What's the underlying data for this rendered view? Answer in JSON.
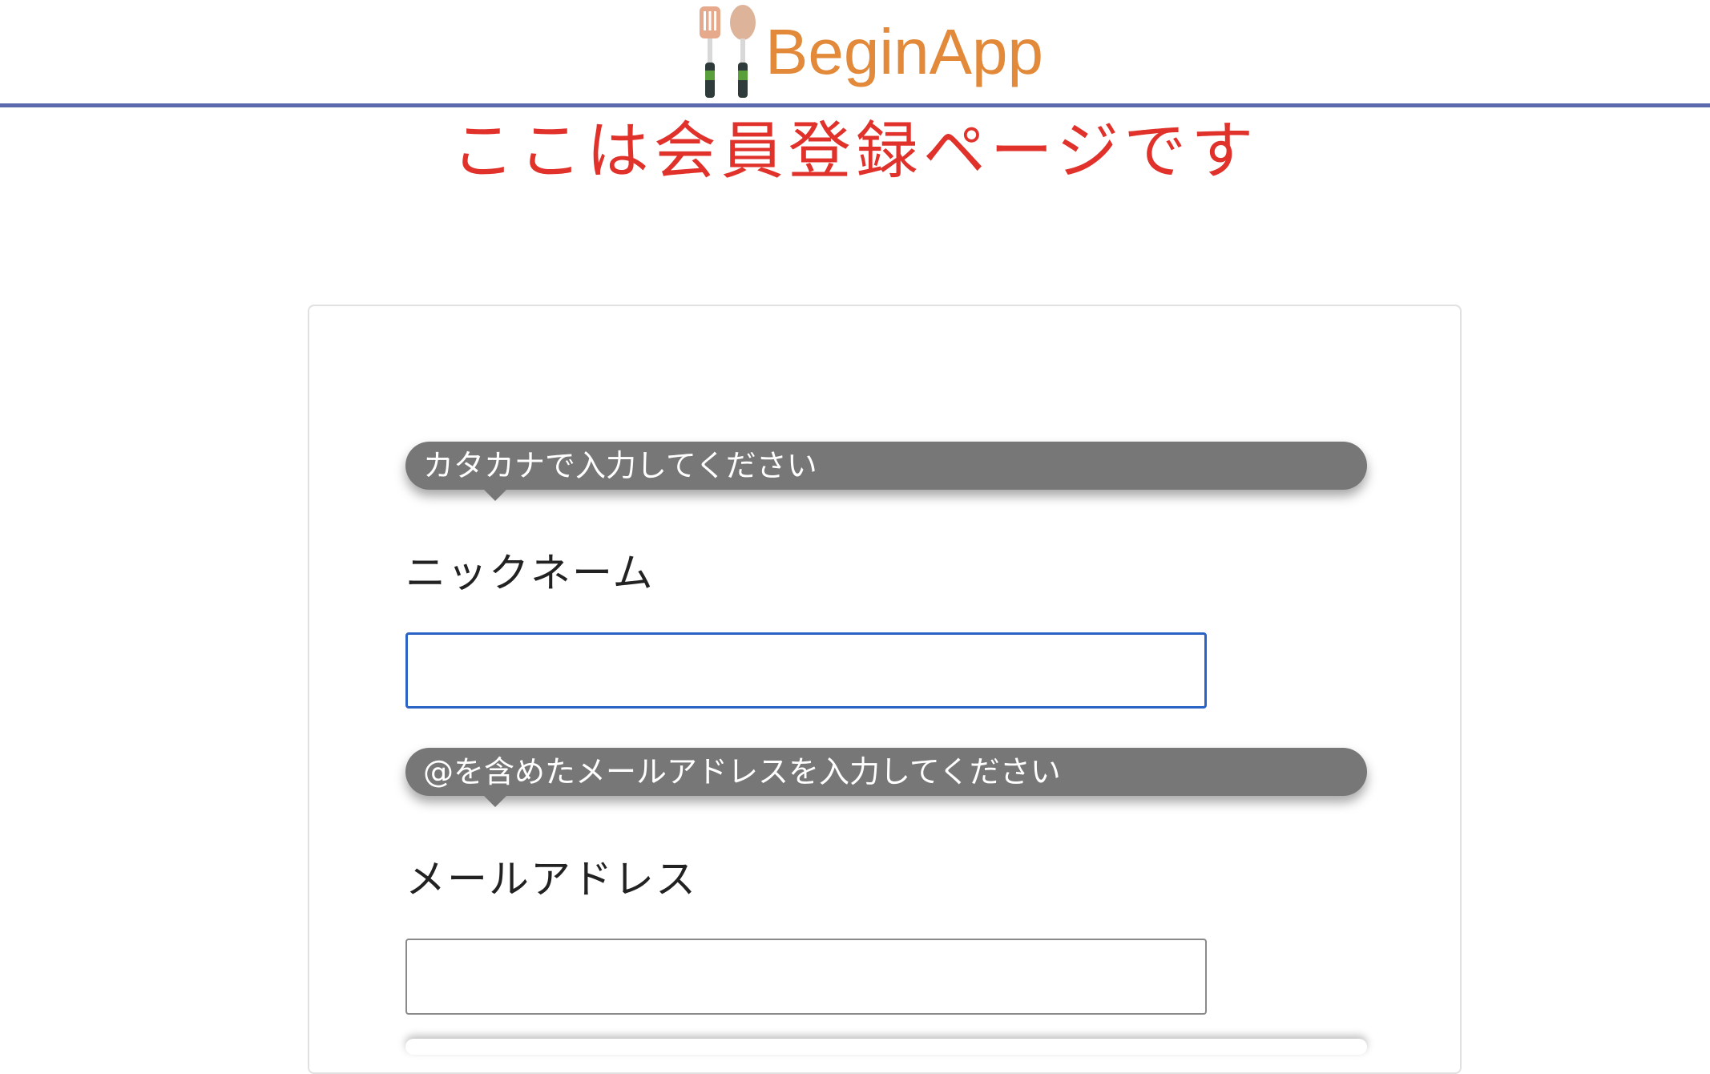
{
  "header": {
    "brand_name": "BeginApp",
    "brand_icon": "cooking-utensils-icon",
    "divider_color": "#5b6aad"
  },
  "page": {
    "title": "ここは会員登録ページです",
    "title_color": "#e0322b"
  },
  "form": {
    "fields": [
      {
        "hint": "カタカナで入力してください",
        "label": "ニックネーム",
        "value": "",
        "focused": true
      },
      {
        "hint": "@を含めたメールアドレスを入力してください",
        "label": "メールアドレス",
        "value": "",
        "focused": false
      }
    ]
  },
  "colors": {
    "brand": "#e2893a",
    "tooltip_bg": "#777777",
    "focus_border": "#2b63c4"
  }
}
